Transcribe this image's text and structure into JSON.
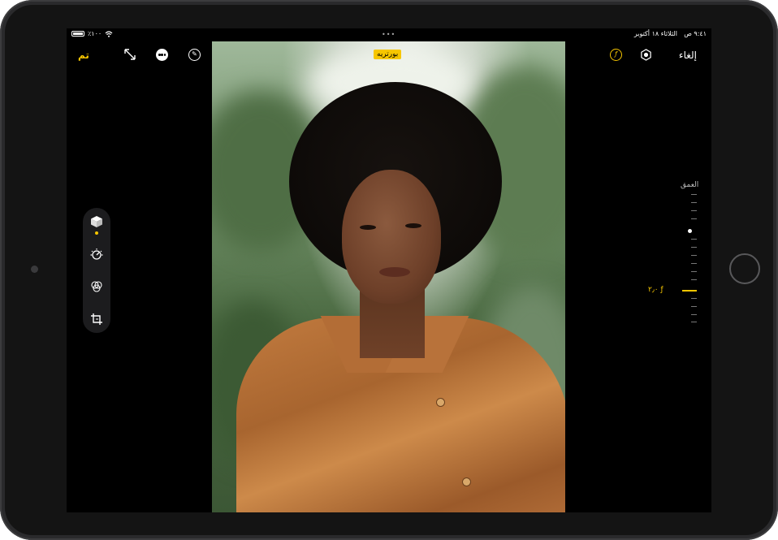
{
  "status_bar": {
    "time": "٩:٤١ ص",
    "date": "الثلاثاء ١٨ أكتوبر",
    "battery": "٪١٠٠"
  },
  "topbar": {
    "done_label": "تم",
    "portrait_label": "بورتريه",
    "cancel_label": "إلغاء",
    "aperture_icon_glyph": "ƒ"
  },
  "toolbar": {
    "tools": [
      {
        "name": "portrait-cube-icon",
        "active": true
      },
      {
        "name": "adjust-dial-icon",
        "active": false
      },
      {
        "name": "filters-icon",
        "active": false
      },
      {
        "name": "crop-rotate-icon",
        "active": false
      }
    ]
  },
  "depth": {
    "label": "العمق",
    "value": "ƒ ٢٫٠"
  },
  "colors": {
    "accent": "#f7c600",
    "background": "#000000"
  }
}
